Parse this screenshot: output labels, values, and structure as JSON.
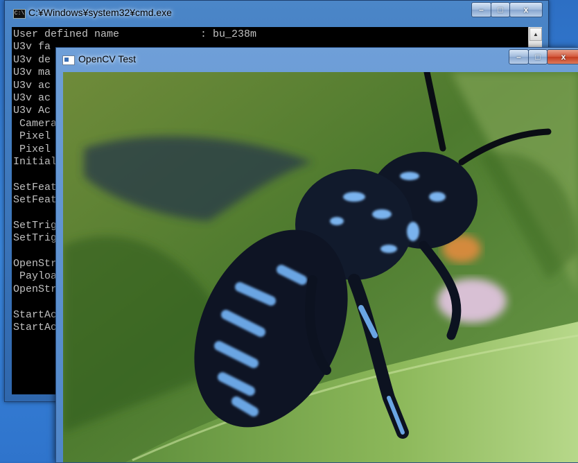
{
  "cmd_window": {
    "title": "C:¥Windows¥system32¥cmd.exe",
    "icon": "console-icon",
    "buttons": {
      "minimize": "–",
      "maximize": "□",
      "close": "x"
    },
    "console_lines": [
      "User defined name             : bu_238m",
      "U3v fa",
      "U3v de",
      "U3v ma",
      "U3v ac",
      "U3v ac",
      "U3v Ac",
      " Camera",
      " Pixel",
      " Pixel",
      "Initial",
      "",
      "SetFeat",
      "SetFeat",
      "",
      "SetTrig",
      "SetTrig",
      "",
      "OpenStr",
      " Payloa",
      "OpenStr",
      "",
      "StartAc",
      "StartAc"
    ]
  },
  "opencv_window": {
    "title": "OpenCV Test",
    "icon": "window-icon",
    "buttons": {
      "minimize": "–",
      "maximize": "□",
      "close": "x"
    },
    "image": "blue-banded-bee-photo"
  },
  "colors": {
    "console_bg": "#000000",
    "console_text": "#c0c0c0",
    "close_red": "#c94a2c",
    "desktop_blue": "#3a86dc"
  }
}
